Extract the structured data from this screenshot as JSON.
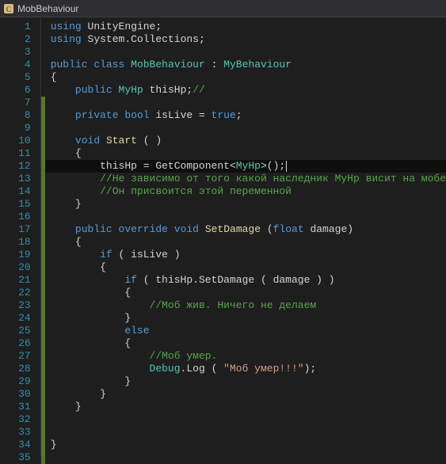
{
  "titlebar": {
    "title": "MobBehaviour"
  },
  "lineNumberStart": 1,
  "lineCount": 35,
  "changedLines": [
    7,
    8,
    9,
    10,
    11,
    12,
    13,
    14,
    15,
    16,
    17,
    18,
    19,
    20,
    21,
    22,
    23,
    24,
    25,
    26,
    27,
    28,
    29,
    30,
    31,
    32,
    33,
    34,
    35
  ],
  "highlightedLine": 12,
  "code": {
    "l1": [
      [
        "kw",
        "using"
      ],
      [
        "txt",
        " "
      ],
      [
        "txt",
        "UnityEngine"
      ],
      [
        "txt",
        ";"
      ]
    ],
    "l2": [
      [
        "kw",
        "using"
      ],
      [
        "txt",
        " "
      ],
      [
        "txt",
        "System"
      ],
      [
        "txt",
        "."
      ],
      [
        "txt",
        "Collections"
      ],
      [
        "txt",
        ";"
      ]
    ],
    "l3": [],
    "l4": [
      [
        "kw",
        "public"
      ],
      [
        "txt",
        " "
      ],
      [
        "kw",
        "class"
      ],
      [
        "txt",
        " "
      ],
      [
        "cls",
        "MobBehaviour"
      ],
      [
        "txt",
        " : "
      ],
      [
        "cls",
        "MyBehaviour"
      ]
    ],
    "l5": [
      [
        "txt",
        "{"
      ]
    ],
    "l6": [
      [
        "txt",
        "    "
      ],
      [
        "kw",
        "public"
      ],
      [
        "txt",
        " "
      ],
      [
        "cls",
        "MyHp"
      ],
      [
        "txt",
        " thisHp;"
      ],
      [
        "cmt",
        "//"
      ]
    ],
    "l7": [],
    "l8": [
      [
        "txt",
        "    "
      ],
      [
        "kw",
        "private"
      ],
      [
        "txt",
        " "
      ],
      [
        "kw",
        "bool"
      ],
      [
        "txt",
        " isLive = "
      ],
      [
        "kw",
        "true"
      ],
      [
        "txt",
        ";"
      ]
    ],
    "l9": [],
    "l10": [
      [
        "txt",
        "    "
      ],
      [
        "kw",
        "void"
      ],
      [
        "txt",
        " "
      ],
      [
        "fn",
        "Start"
      ],
      [
        "txt",
        " "
      ],
      [
        "txt",
        "( )"
      ]
    ],
    "l11": [
      [
        "txt",
        "    {"
      ]
    ],
    "l12": [
      [
        "txt",
        "        thisHp = "
      ],
      [
        "txt",
        "GetComponent"
      ],
      [
        "txt",
        "<"
      ],
      [
        "cls",
        "MyHp"
      ],
      [
        "txt",
        ">"
      ],
      [
        "txt",
        "();"
      ]
    ],
    "l13": [
      [
        "txt",
        "        "
      ],
      [
        "cmt",
        "//Не зависимо от того какой наследник MyHp висит на мобе"
      ]
    ],
    "l14": [
      [
        "txt",
        "        "
      ],
      [
        "cmt",
        "//Он присвоится этой переменной"
      ]
    ],
    "l15": [
      [
        "txt",
        "    }"
      ]
    ],
    "l16": [],
    "l17": [
      [
        "txt",
        "    "
      ],
      [
        "kw",
        "public"
      ],
      [
        "txt",
        " "
      ],
      [
        "kw",
        "override"
      ],
      [
        "txt",
        " "
      ],
      [
        "kw",
        "void"
      ],
      [
        "txt",
        " "
      ],
      [
        "fn",
        "SetDamage"
      ],
      [
        "txt",
        " ("
      ],
      [
        "kw",
        "float"
      ],
      [
        "txt",
        " damage)"
      ]
    ],
    "l18": [
      [
        "txt",
        "    {"
      ]
    ],
    "l19": [
      [
        "txt",
        "        "
      ],
      [
        "kw",
        "if"
      ],
      [
        "txt",
        " ( isLive )"
      ]
    ],
    "l20": [
      [
        "txt",
        "        {"
      ]
    ],
    "l21": [
      [
        "txt",
        "            "
      ],
      [
        "kw",
        "if"
      ],
      [
        "txt",
        " ( thisHp.SetDamage ( damage ) )"
      ]
    ],
    "l22": [
      [
        "txt",
        "            {"
      ]
    ],
    "l23": [
      [
        "txt",
        "                "
      ],
      [
        "cmt",
        "//Моб жив. Ничего не делаем"
      ]
    ],
    "l24": [
      [
        "txt",
        "            }"
      ]
    ],
    "l25": [
      [
        "txt",
        "            "
      ],
      [
        "kw",
        "else"
      ]
    ],
    "l26": [
      [
        "txt",
        "            {"
      ]
    ],
    "l27": [
      [
        "txt",
        "                "
      ],
      [
        "cmt",
        "//Моб умер."
      ]
    ],
    "l28": [
      [
        "txt",
        "                "
      ],
      [
        "cls",
        "Debug"
      ],
      [
        "txt",
        "."
      ],
      [
        "txt",
        "Log ( "
      ],
      [
        "str",
        "\"Моб умер!!!\""
      ],
      [
        "txt",
        ");"
      ]
    ],
    "l29": [
      [
        "txt",
        "            }"
      ]
    ],
    "l30": [
      [
        "txt",
        "        }"
      ]
    ],
    "l31": [
      [
        "txt",
        "    }"
      ]
    ],
    "l32": [],
    "l33": [],
    "l34": [
      [
        "txt",
        "}"
      ]
    ],
    "l35": []
  }
}
